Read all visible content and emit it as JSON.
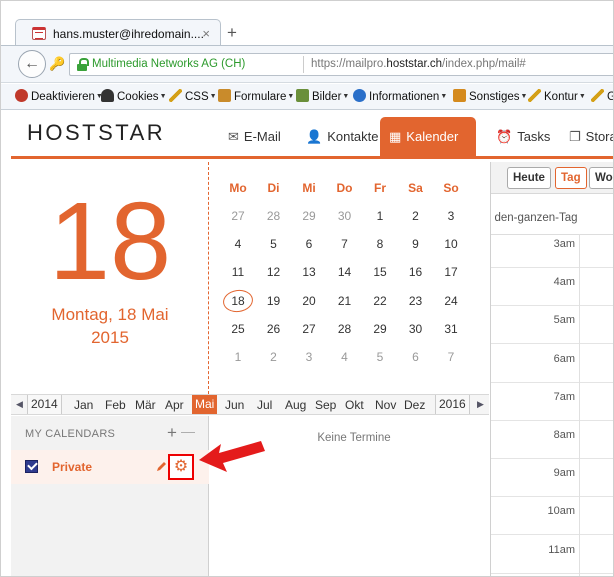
{
  "browser": {
    "tab_title": "hans.muster@ihredomain....",
    "tab_close": "×",
    "new_tab": "+",
    "org": "Multimedia Networks AG (CH)",
    "url_prefix": "https://mailpro.",
    "url_domain": "hoststar.ch",
    "url_suffix": "/index.php/mail#"
  },
  "addons": [
    {
      "label": "Deaktivieren",
      "icon": "no-entry-icon",
      "color": "#c0392b"
    },
    {
      "label": "Cookies",
      "icon": "person-icon",
      "color": "#333333"
    },
    {
      "label": "CSS",
      "icon": "pencil-icon",
      "color": "#d4a017"
    },
    {
      "label": "Formulare",
      "icon": "clipboard-icon",
      "color": "#c98b2b"
    },
    {
      "label": "Bilder",
      "icon": "image-icon",
      "color": "#6a8f3a"
    },
    {
      "label": "Informationen",
      "icon": "info-icon",
      "color": "#2a6fc9"
    },
    {
      "label": "Sonstiges",
      "icon": "box-icon",
      "color": "#d48a1e"
    },
    {
      "label": "Kontur",
      "icon": "pencil-icon",
      "color": "#d4a017"
    },
    {
      "label": "G",
      "icon": "pencil-icon",
      "color": "#d4a017"
    }
  ],
  "app": {
    "logo": "HOSTSTAR",
    "accent": "#e2652f",
    "nav": [
      {
        "label": "E-Mail",
        "icon": "mail-icon",
        "glyph": "✉"
      },
      {
        "label": "Kontakte",
        "icon": "contacts-icon",
        "glyph": "👤"
      },
      {
        "label": "Kalender",
        "icon": "calendar-icon",
        "glyph": "▦",
        "active": true
      },
      {
        "label": "Tasks",
        "icon": "alarm-icon",
        "glyph": "⏰"
      },
      {
        "label": "Stora",
        "icon": "files-icon",
        "glyph": "❐"
      }
    ]
  },
  "date": {
    "day": "18",
    "line1": "Montag, 18 Mai",
    "line2": "2015"
  },
  "minical": {
    "weekdays": [
      "Mo",
      "Di",
      "Mi",
      "Do",
      "Fr",
      "Sa",
      "So"
    ],
    "weeks": [
      [
        "27",
        "28",
        "29",
        "30",
        "1",
        "2",
        "3"
      ],
      [
        "4",
        "5",
        "6",
        "7",
        "8",
        "9",
        "10"
      ],
      [
        "11",
        "12",
        "13",
        "14",
        "15",
        "16",
        "17"
      ],
      [
        "18",
        "19",
        "20",
        "21",
        "22",
        "23",
        "24"
      ],
      [
        "25",
        "26",
        "27",
        "28",
        "29",
        "30",
        "31"
      ],
      [
        "1",
        "2",
        "3",
        "4",
        "5",
        "6",
        "7"
      ]
    ],
    "today": "18"
  },
  "months": {
    "prev_year": "2014",
    "next_year": "2016",
    "items": [
      "Jan",
      "Feb",
      "Mär",
      "Apr",
      "Mai",
      "Jun",
      "Jul",
      "Aug",
      "Sep",
      "Okt",
      "Nov",
      "Dez"
    ],
    "active": "Mai"
  },
  "calendars": {
    "header": "MY CALENDARS",
    "add": "+",
    "remove": "—",
    "items": [
      {
        "name": "Private",
        "color": "#2f3b8f"
      }
    ]
  },
  "events": {
    "empty": "Keine Termine"
  },
  "dayview": {
    "buttons": [
      "Heute",
      "Tag",
      "Wo"
    ],
    "selected": "Tag",
    "allday": "den-ganzen-Tag",
    "hours": [
      "3am",
      "4am",
      "5am",
      "6am",
      "7am",
      "8am",
      "9am",
      "10am",
      "11am"
    ]
  }
}
